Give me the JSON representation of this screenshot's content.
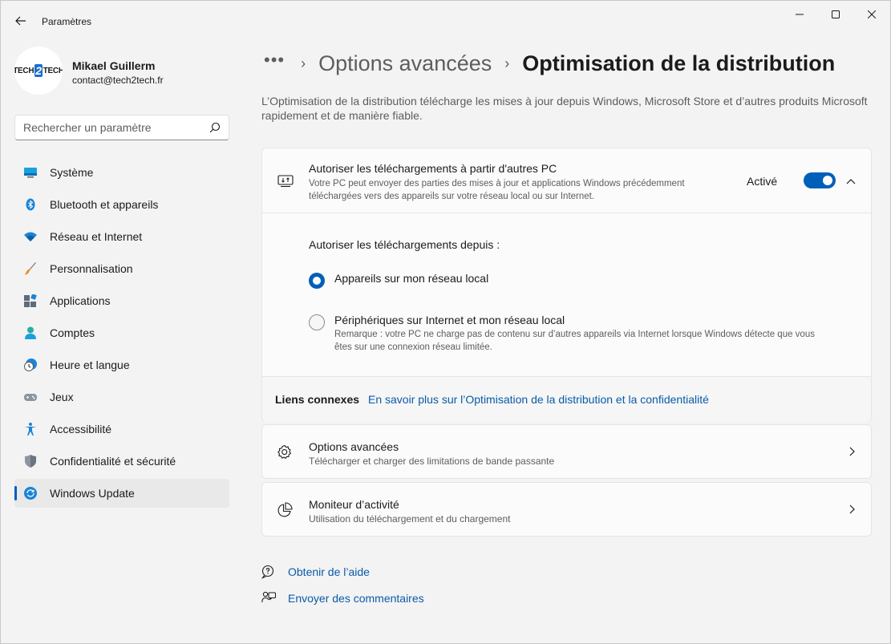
{
  "app": {
    "title": "Paramètres"
  },
  "user": {
    "name": "Mikael Guillerm",
    "email": "contact@tech2tech.fr",
    "avatar_logo": [
      "TECH",
      "2",
      "TECH"
    ]
  },
  "search": {
    "placeholder": "Rechercher un paramètre"
  },
  "sidebar": {
    "items": [
      {
        "label": "Système",
        "icon": "monitor-icon"
      },
      {
        "label": "Bluetooth et appareils",
        "icon": "bluetooth-icon"
      },
      {
        "label": "Réseau et Internet",
        "icon": "wifi-icon"
      },
      {
        "label": "Personnalisation",
        "icon": "paintbrush-icon"
      },
      {
        "label": "Applications",
        "icon": "apps-icon"
      },
      {
        "label": "Comptes",
        "icon": "person-icon"
      },
      {
        "label": "Heure et langue",
        "icon": "clock-globe-icon"
      },
      {
        "label": "Jeux",
        "icon": "gamepad-icon"
      },
      {
        "label": "Accessibilité",
        "icon": "accessibility-icon"
      },
      {
        "label": "Confidentialité et sécurité",
        "icon": "shield-icon"
      },
      {
        "label": "Windows Update",
        "icon": "sync-icon",
        "active": true
      }
    ]
  },
  "breadcrumb": {
    "more": "•••",
    "sep": "›",
    "parent": "Options avancées",
    "current": "Optimisation de la distribution"
  },
  "description": "L’Optimisation de la distribution télécharge les mises à jour depuis Windows, Microsoft Store et d’autres produits Microsoft rapidement et de manière fiable.",
  "allow_card": {
    "title": "Autoriser les téléchargements à partir d'autres PC",
    "subtitle": "Votre PC peut envoyer des parties des mises à jour et applications Windows précédemment téléchargées vers des appareils sur votre réseau local ou sur Internet.",
    "status": "Activé",
    "toggle_on": true,
    "allow_from_label": "Autoriser les téléchargements depuis :",
    "options": [
      {
        "label": "Appareils sur mon réseau local",
        "checked": true
      },
      {
        "label": "Périphériques sur Internet et mon réseau local",
        "checked": false,
        "note": "Remarque : votre PC ne charge pas de contenu sur d’autres appareils via Internet lorsque Windows détecte que vous êtes sur une connexion réseau limitée."
      }
    ],
    "related": {
      "label": "Liens connexes",
      "link": "En savoir plus sur l’Optimisation de la distribution et la confidentialité"
    }
  },
  "rows": [
    {
      "title": "Options avancées",
      "subtitle": "Télécharger et charger des limitations de bande passante",
      "icon": "gear-icon"
    },
    {
      "title": "Moniteur d’activité",
      "subtitle": "Utilisation du téléchargement et du chargement",
      "icon": "pie-chart-icon"
    }
  ],
  "footer": {
    "help": "Obtenir de l’aide",
    "feedback": "Envoyer des commentaires"
  },
  "colors": {
    "accent": "#005fb8",
    "link": "#0a5aa8",
    "background": "#f3f3f3",
    "card": "#fbfbfb"
  }
}
